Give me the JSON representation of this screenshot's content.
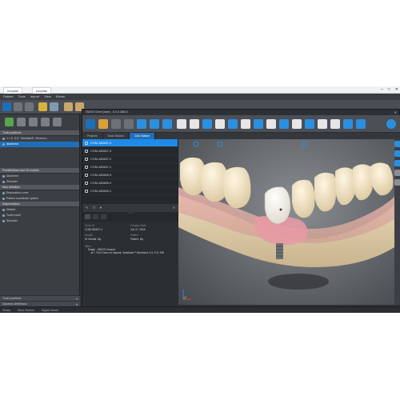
{
  "outer_window": {
    "tabs": [
      "exoplan",
      "exoplan"
    ],
    "win_min": "–",
    "win_max": "□",
    "win_close": "✕"
  },
  "menu": {
    "items": [
      "Patient",
      "Tools",
      "Import",
      "View",
      "Extras"
    ]
  },
  "left_panel": {
    "sections": [
      {
        "title": "Tooth positions",
        "items": [
          "1 × Z, S.E. Obsidian®, Venecon...",
          "Abutment"
        ]
      },
      {
        "title": "Predefinitions and 3D models",
        "items": [
          "Abutment",
          "Shoulder"
        ]
      },
      {
        "title": "New definition",
        "items": [
          "Restoration curve",
          "Patient coordinate system"
        ]
      },
      {
        "title": "Segmentation",
        "items": [
          "Default",
          "Tooth mesh",
          "Shoulder"
        ]
      }
    ],
    "selected_item_index": 1,
    "bottom_fields": [
      "Tooth positions",
      "Dynamic definitions"
    ]
  },
  "statusbar": {
    "left": "Ready",
    "middle": "Work Section",
    "right": "Digital Viewer"
  },
  "dialog": {
    "title": "DWOS Client (user) - 8.0.0.38613",
    "close": "✕",
    "tabs": [
      "Projects",
      "Scan Search",
      "CAD Station"
    ],
    "active_tab_index": 2
  },
  "projects": {
    "items": [
      "COM-180627-4",
      "COM-180627-3",
      "COM-180627-2",
      "COM-180627-1",
      "COM-180609-3",
      "COM-180609-2",
      "COM-180609-1"
    ],
    "selected_index": 0,
    "pager": "•••••",
    "close": "✕"
  },
  "order_info": {
    "order_id_label": "Order ID",
    "order_id": "COM-180627-4",
    "creation_date_label": "Creation Date",
    "creation_date": "Jun 27, 2018",
    "dentist_label": "Dentist",
    "dentist": "Dr Dentist, My",
    "patient_label": "Patient",
    "patient": "Patient, My",
    "items_label": "Items",
    "item_1": "Single - DWOS Ceramic",
    "item_2": "■ 7. Full Crown on Implant, Variobase™ Abutment, 4.5, S.E. DW"
  },
  "viewport_footer": {
    "percent": "0%",
    "clip_planes": "Clip Planes",
    "view_type": "View Type",
    "zoom": "01%"
  },
  "colors": {
    "accent": "#1f8ae8",
    "panel_dark": "#25282c",
    "gum": "#e4a8a6",
    "tooth": "#e8dcc0"
  }
}
